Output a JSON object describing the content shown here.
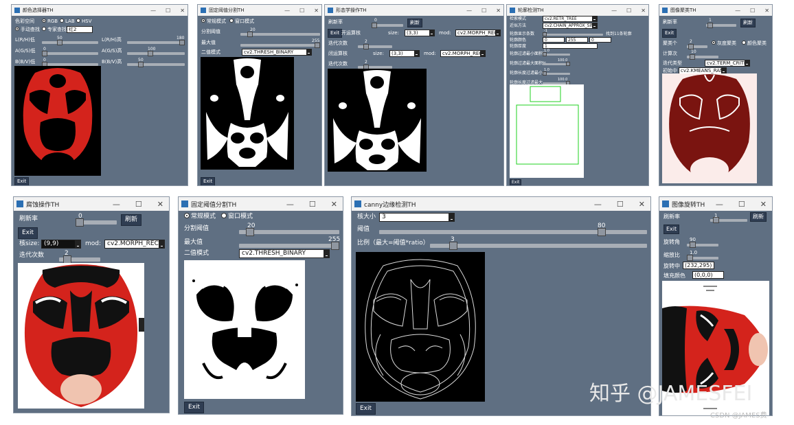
{
  "windows": {
    "color": {
      "title": "颜色选择器TH",
      "label_space": "色彩空间",
      "radios": [
        "RGB",
        "LAB",
        "HSV"
      ],
      "mode_manual": "手动查找",
      "mode_expert": "专家查找",
      "expert_value": "红2",
      "l_min": "L(R/H)低",
      "l_min_val": "50",
      "l_max": "L(R/H)高",
      "l_max_val": "180",
      "a_min": "A(G/S)低",
      "a_min_val": "0",
      "a_max": "A(G/S)高",
      "a_max_val": "100",
      "b_min": "B(B/V)低",
      "b_min_val": "0",
      "b_max": "B(B/V)高",
      "b_max_val": "50",
      "exit": "Exit"
    },
    "thresh_small": {
      "title": "固定阈值分割TH",
      "mode_normal": "常规模式",
      "mode_window": "窗口模式",
      "split": "分割阈值",
      "split_val": "20",
      "max": "最大值",
      "max_val": "255",
      "binary": "二值模式",
      "binary_val": "cv2.THRESH_BINARY",
      "exit": "Exit"
    },
    "morph_small": {
      "title": "形态学操作TH",
      "refresh_rate": "刷新率",
      "refresh_val": "0",
      "refresh": "刷新",
      "exit": "Exit",
      "open_kernel": "开运算核",
      "size": "size:",
      "size_val": "(3,3)",
      "mod": "mod:",
      "mod_val": "cv2.MORPH_REC",
      "iter": "迭代次数",
      "iter_val": "2",
      "close_kernel": "闭运算核",
      "size2_val": "(3,3)",
      "mod2_val": "cv2.MORPH_REC",
      "iter2": "迭代次数",
      "iter2_val": "2"
    },
    "contour": {
      "title": "轮廓检测TH",
      "retr_l": "检索模式",
      "retr": "cv2.RETR_TREE",
      "approx_l": "近似方法",
      "approx": "cv2.CHAIN_APPROX_SIMPLE",
      "show_l": "轮廓显示条数",
      "show_val": "-1",
      "found": "找到11条轮廓",
      "color_l": "轮廓颜色",
      "c1": "0",
      "c2": "255",
      "c3": "0",
      "thick_l": "轮廓厚度",
      "thick_val": "1",
      "minarea_l": "轮廓过滤最小面积%",
      "minarea_val": "1.0",
      "maxarea_l": "轮廓过滤最大面积%",
      "maxarea_val": "100.0",
      "minlen_l": "轮廓长度过滤最小",
      "minlen_val": "1.0",
      "maxlen_l": "轮廓长度过滤最大",
      "maxlen_val": "100.0",
      "exit": "Exit"
    },
    "cluster": {
      "title": "图像聚类TH",
      "refresh_rate": "刷新率",
      "refresh_val": "1",
      "refresh": "刷新",
      "exit": "Exit",
      "k_l": "聚类个",
      "k_val": "2",
      "gray": "灰度聚类",
      "color": "颜色聚类",
      "iter_l": "计算次",
      "iter_val": "10",
      "crit_l": "迭代类型",
      "crit": "cv2.TERM_CRITE",
      "init_l": "初始中",
      "init": "cv2.KMEANS_RAN"
    },
    "erode": {
      "title": "腐蚀操作TH",
      "refresh_rate": "刷新率",
      "refresh_val": "0",
      "refresh": "刷新",
      "exit": "Exit",
      "ksize": "核size:",
      "ksize_val": "(9,9)",
      "mod": "mod:",
      "mod_val": "cv2.MORPH_REC",
      "iter": "迭代次数",
      "iter_val": "2"
    },
    "thresh_big": {
      "title": "固定阈值分割TH",
      "mode_normal": "常规模式",
      "mode_window": "窗口模式",
      "split": "分割阈值",
      "split_val": "20",
      "max": "最大值",
      "max_val": "255",
      "binary": "二值模式",
      "binary_val": "cv2.THRESH_BINARY",
      "exit": "Exit"
    },
    "canny": {
      "title": "canny边缘检测TH",
      "ksize": "核大小",
      "ksize_val": "3",
      "thresh": "阈值",
      "thresh_val": "80",
      "ratio": "比例（最大=阈值*ratio）",
      "ratio_val": "3",
      "exit": "Exit"
    },
    "rotate": {
      "title": "图像旋转TH",
      "refresh_rate": "刷新率",
      "refresh_val": "1",
      "refresh": "刷新",
      "exit": "Exit",
      "angle": "旋转角",
      "angle_val": "90",
      "scale": "缩放比",
      "scale_val": "1.0",
      "center": "旋转中",
      "center_val": "(232,295)",
      "fill": "填充颜色",
      "fill_val": "(0,0,0)"
    }
  },
  "watermark": {
    "main": "知乎 @JAMESFEI",
    "sub": "CSDN @JAMES费"
  },
  "colors": {
    "panel": "#5f6f82",
    "red": "#d4231c",
    "darkred": "#7a1410"
  }
}
